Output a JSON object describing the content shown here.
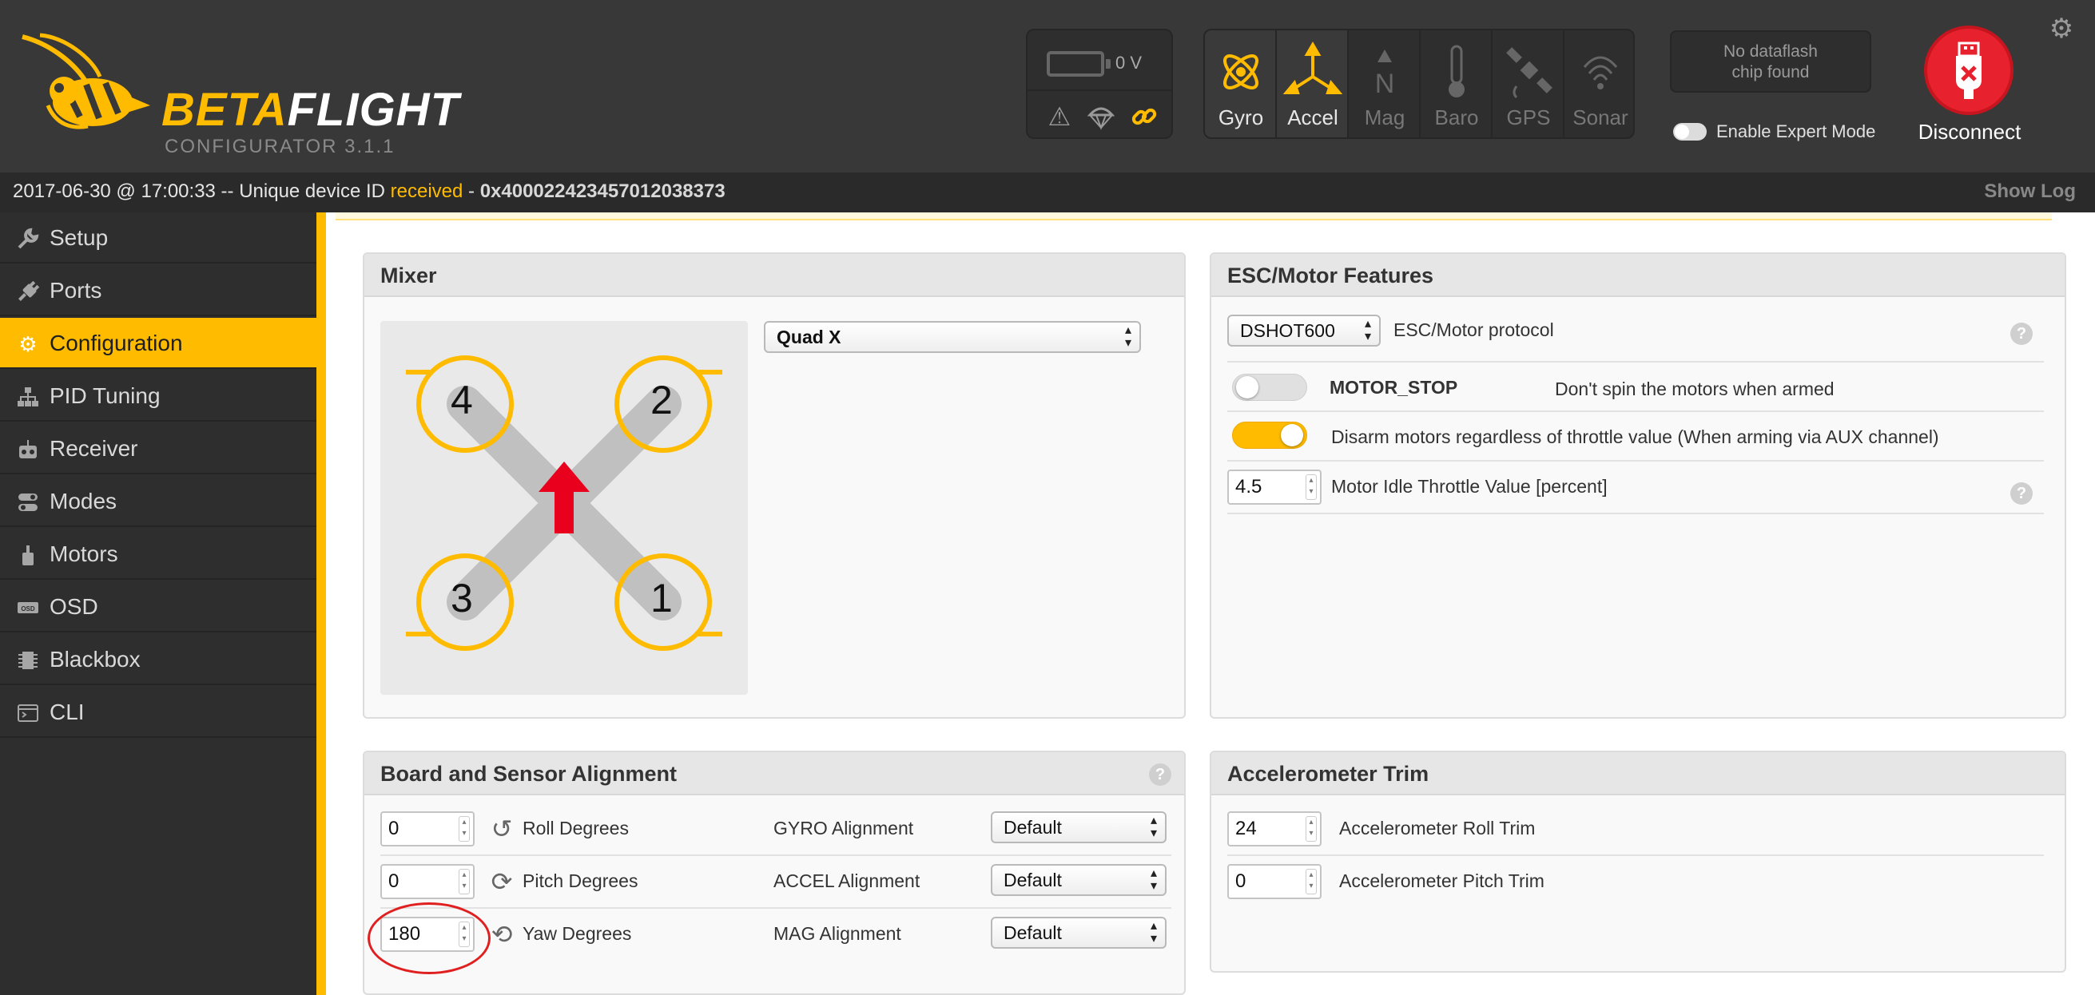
{
  "header": {
    "logo_word_a": "BETA",
    "logo_word_b": "FLIGHT",
    "logo_sub": "CONFIGURATOR  3.1.1",
    "battery_voltage": "0 V",
    "sensors": [
      {
        "label": "Gyro",
        "active": true
      },
      {
        "label": "Accel",
        "active": true
      },
      {
        "label": "Mag",
        "active": false
      },
      {
        "label": "Baro",
        "active": false
      },
      {
        "label": "GPS",
        "active": false
      },
      {
        "label": "Sonar",
        "active": false
      }
    ],
    "dataflash_line1": "No dataflash",
    "dataflash_line2": "chip found",
    "expert_mode_label": "Enable Expert Mode",
    "disconnect_label": "Disconnect"
  },
  "log": {
    "prefix": "2017-06-30 @ 17:00:33 -- Unique device ID ",
    "status": "received",
    "sep": " - ",
    "device_id": "0x400022423457012038373",
    "show_log": "Show Log"
  },
  "sidebar": {
    "items": [
      {
        "label": "Setup",
        "icon": "wrench-icon"
      },
      {
        "label": "Ports",
        "icon": "plug-icon"
      },
      {
        "label": "Configuration",
        "icon": "gear-icon",
        "active": true
      },
      {
        "label": "PID Tuning",
        "icon": "sitemap-icon"
      },
      {
        "label": "Receiver",
        "icon": "robot-icon"
      },
      {
        "label": "Modes",
        "icon": "toggles-icon"
      },
      {
        "label": "Motors",
        "icon": "motor-icon"
      },
      {
        "label": "OSD",
        "icon": "osd-icon"
      },
      {
        "label": "Blackbox",
        "icon": "chip-icon"
      },
      {
        "label": "CLI",
        "icon": "terminal-icon"
      }
    ]
  },
  "mixer": {
    "title": "Mixer",
    "type_selected": "Quad X",
    "motor_labels": [
      "4",
      "2",
      "3",
      "1"
    ]
  },
  "esc": {
    "title": "ESC/Motor Features",
    "protocol_selected": "DSHOT600",
    "protocol_label": "ESC/Motor protocol",
    "motor_stop_name": "MOTOR_STOP",
    "motor_stop_desc": "Don't spin the motors when armed",
    "motor_stop_on": false,
    "disarm_desc": "Disarm motors regardless of throttle value (When arming via AUX channel)",
    "disarm_on": true,
    "idle_value": "4.5",
    "idle_label": "Motor Idle Throttle Value [percent]"
  },
  "alignment": {
    "title": "Board and Sensor Alignment",
    "roll_value": "0",
    "roll_label": "Roll Degrees",
    "pitch_value": "0",
    "pitch_label": "Pitch Degrees",
    "yaw_value": "180",
    "yaw_label": "Yaw Degrees",
    "gyro_label": "GYRO Alignment",
    "accel_label": "ACCEL Alignment",
    "mag_label": "MAG Alignment",
    "gyro_value": "Default",
    "accel_value": "Default",
    "mag_value": "Default"
  },
  "acc_trim": {
    "title": "Accelerometer Trim",
    "roll_value": "24",
    "roll_label": "Accelerometer Roll Trim",
    "pitch_value": "0",
    "pitch_label": "Accelerometer Pitch Trim"
  },
  "colors": {
    "accent": "#ffbb00",
    "header_bg": "#383838",
    "disconnect_red": "#e8212e",
    "arrow_red": "#e8001c"
  }
}
